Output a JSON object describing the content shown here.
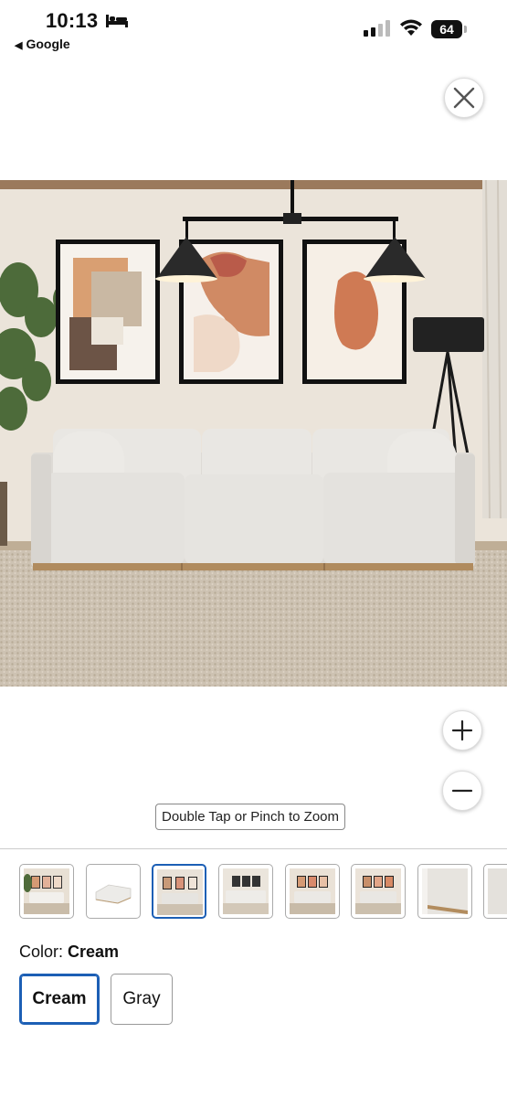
{
  "status_bar": {
    "time": "10:13",
    "back_app_label": "Google",
    "battery_level": "64"
  },
  "viewer": {
    "zoom_hint": "Double Tap or Pinch to Zoom",
    "selected_thumbnail": 3,
    "thumbnail_count": 8
  },
  "product": {
    "color_label": "Color:",
    "color_value": "Cream",
    "options": [
      "Cream",
      "Gray"
    ],
    "selected_option": "Cream"
  },
  "colors": {
    "accent": "#1c5fb5",
    "wall": "#e9e1d7",
    "sofa": "#e5e3df",
    "rug": "#cbbfae"
  },
  "icons": {
    "close": "close-icon",
    "zoom_in": "plus-icon",
    "zoom_out": "minus-icon",
    "sleep": "bed-icon",
    "signal": "cellular-signal-icon",
    "wifi": "wifi-icon",
    "battery": "battery-icon"
  }
}
